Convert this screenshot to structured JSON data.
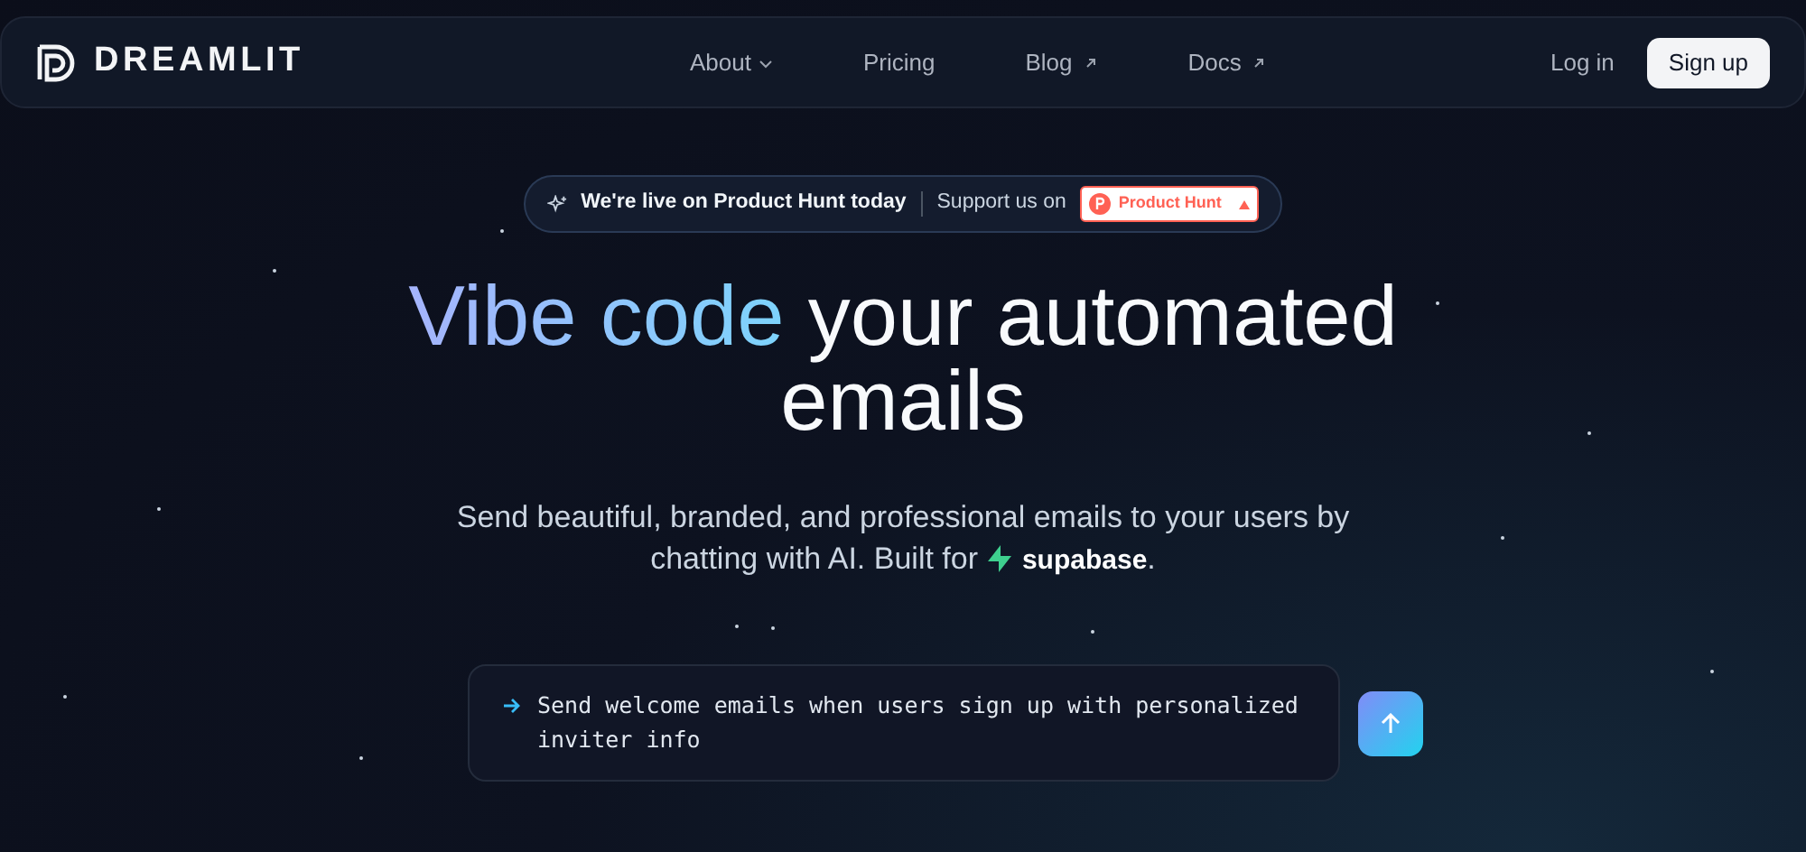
{
  "nav": {
    "brand": "DREAMLIT",
    "links": [
      {
        "label": "About",
        "kind": "dropdown"
      },
      {
        "label": "Pricing",
        "kind": "plain"
      },
      {
        "label": "Blog",
        "kind": "external"
      },
      {
        "label": "Docs",
        "kind": "external"
      }
    ],
    "login": "Log in",
    "signup": "Sign up"
  },
  "banner": {
    "headline": "We're live on Product Hunt today",
    "support": "Support us on",
    "badge": "Product Hunt"
  },
  "hero": {
    "title_accent": "Vibe code",
    "title_rest": "your automated emails",
    "subtitle": "Send beautiful, branded, and professional emails to your users by chatting with AI. Built for",
    "brand": "supabase",
    "period": "."
  },
  "prompt": {
    "value": "Send welcome emails when users sign up with personalized inviter info"
  }
}
